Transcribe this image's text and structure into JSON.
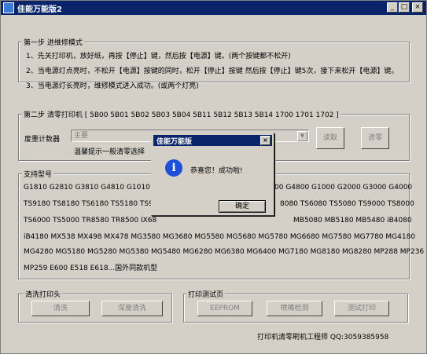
{
  "window": {
    "title": "佳能万能版2",
    "min": "_",
    "max": "□",
    "close": "×"
  },
  "step1": {
    "legend": "第一步 进维修模式",
    "lines": [
      "1、先关打印机，放好纸，再按【停止】键，然后按【电源】键。(两个按键都不松开)",
      "2、当电源灯点亮时，不松开【电源】按键的同时，松开【停止】按键 然后按【停止】键5次，接下来松开【电源】键。",
      "3、当电源灯长亮时，维修模式进入成功。(或两个灯亮)"
    ]
  },
  "step2": {
    "legend": "第二步 清零打印机 [ 5B00 5B01 5B02 5B03 5B04 5B11 5B12 5B13 5B14 1700 1701 1702  ]",
    "counter_label": "废墨计数器",
    "combo_value": "主要",
    "hint": "温馨提示一般清零选择",
    "read_button": "读取",
    "clear_button": "清零"
  },
  "models": {
    "legend": "支持型号",
    "lines": [
      [
        "G1810 G2810 G3810 G4810 G1010 G20",
        "00 G4800 G1000 G2000 G3000 G4000"
      ],
      [
        "TS9180 TS8180 TS6180 TS5180 TS91",
        "8080 TS6080 TS5080 TS9000 TS8000"
      ],
      [
        "TS6000 TS5000 TR8580 TR8500 IX68",
        "MB5080 MB5180 MB5480 iB4080"
      ],
      [
        "iB4180  MX538 MX498 MX478  MG3580 MG3680 MG5580 MG5680 MG5780 MG6680 MG7580 MG7780  MG4180"
      ],
      [
        "MG4280 MG5180 MG5280 MG5380 MG5480 MG6280 MG6380 MG6400 MG7180 MG8180 MG8280 MP288 MP236"
      ],
      [
        "MP259 E600 E518  E618...国外同款机型"
      ]
    ]
  },
  "clean": {
    "legend": "清洗打印头",
    "clean_button": "清洗",
    "deep_button": "深度清洗"
  },
  "test": {
    "legend": "打印测试页",
    "eeprom_button": "EEPROM",
    "nozzle_button": "喷嘴检测",
    "test_button": "测试打印"
  },
  "footer": "打印机清零刷机工程师 QQ:3059385958",
  "dialog": {
    "title": "佳能万能版",
    "close": "×",
    "icon": "i",
    "message": "恭喜您！成功啦!",
    "ok": "确定"
  }
}
